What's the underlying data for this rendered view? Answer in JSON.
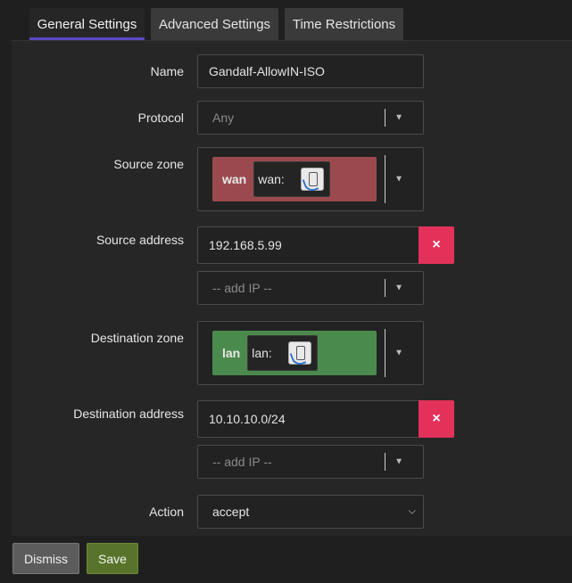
{
  "tabs": [
    {
      "label": "General Settings",
      "active": true
    },
    {
      "label": "Advanced Settings",
      "active": false
    },
    {
      "label": "Time Restrictions",
      "active": false
    }
  ],
  "form": {
    "name": {
      "label": "Name",
      "value": "Gandalf-AllowIN-ISO"
    },
    "protocol": {
      "label": "Protocol",
      "value": "Any"
    },
    "source_zone": {
      "label": "Source zone",
      "zone": "wan",
      "chip": "wan:",
      "color": "#9a4a4e"
    },
    "source_address": {
      "label": "Source address",
      "value": "192.168.5.99",
      "add_placeholder": "-- add IP --",
      "remove": "×"
    },
    "destination_zone": {
      "label": "Destination zone",
      "zone": "lan",
      "chip": "lan:",
      "color": "#4b8a4d"
    },
    "destination_address": {
      "label": "Destination address",
      "value": "10.10.10.0/24",
      "add_placeholder": "-- add IP --",
      "remove": "×"
    },
    "action": {
      "label": "Action",
      "value": "accept",
      "options": [
        "accept"
      ]
    }
  },
  "footer": {
    "dismiss_label": "Dismiss",
    "save_label": "Save"
  },
  "colors": {
    "active_tab_underline": "#5b4ac4",
    "remove_button": "#e3325a",
    "save_button": "#58742b",
    "dismiss_button": "#5c5c5c"
  },
  "icons": {
    "dropdown": "caret-down-icon",
    "remove": "close-icon",
    "network": "network-interface-icon"
  }
}
